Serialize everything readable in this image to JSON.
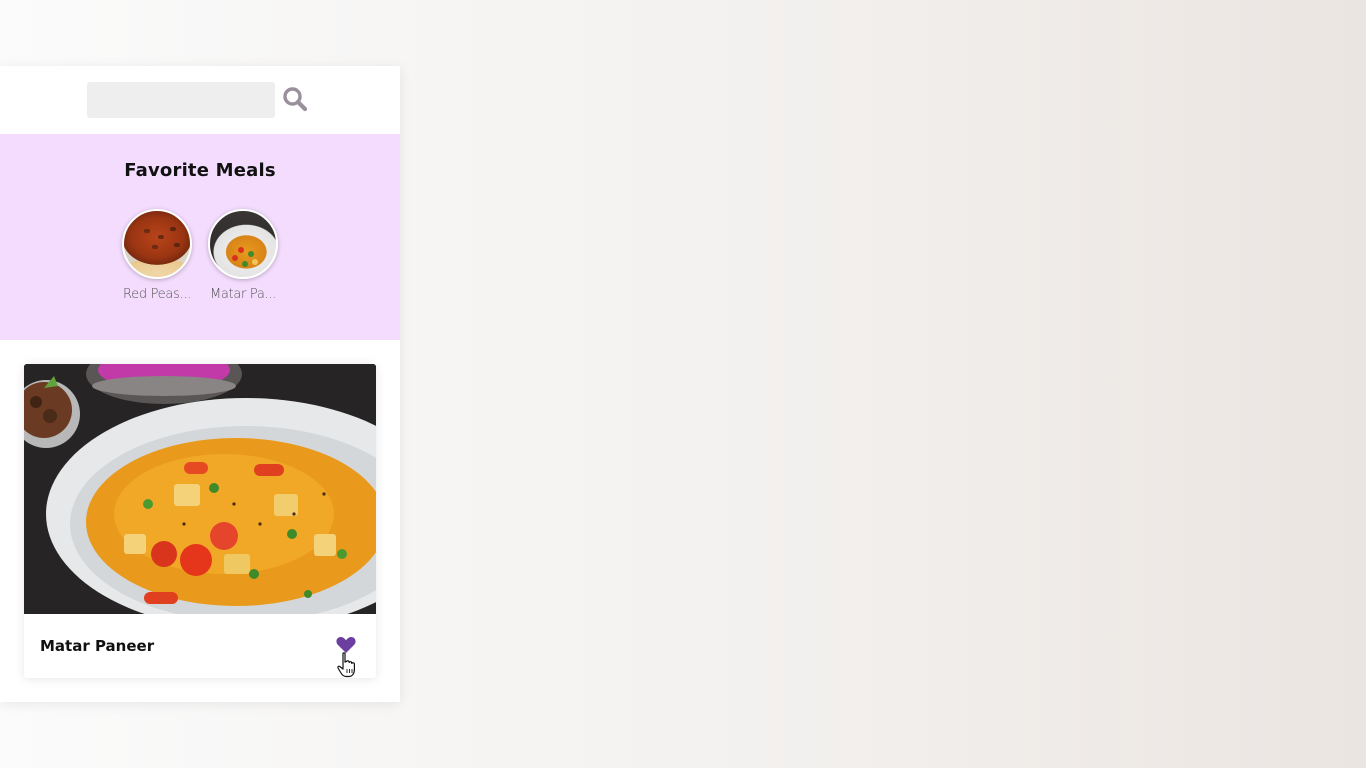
{
  "search": {
    "value": "",
    "placeholder": "",
    "icon": "search-icon"
  },
  "favorites": {
    "title": "Favorite Meals",
    "items": [
      {
        "label": "Red Peas Soup",
        "display": "Red Peas..."
      },
      {
        "label": "Matar Paneer",
        "display": "Matar Pa..."
      }
    ]
  },
  "meal": {
    "name": "Matar Paneer",
    "favorited": true,
    "favorite_icon": "heart-icon"
  },
  "colors": {
    "accent": "#6a3fa0",
    "favorites_bg": "#f3dcfd",
    "search_icon": "#9a8f9c"
  }
}
